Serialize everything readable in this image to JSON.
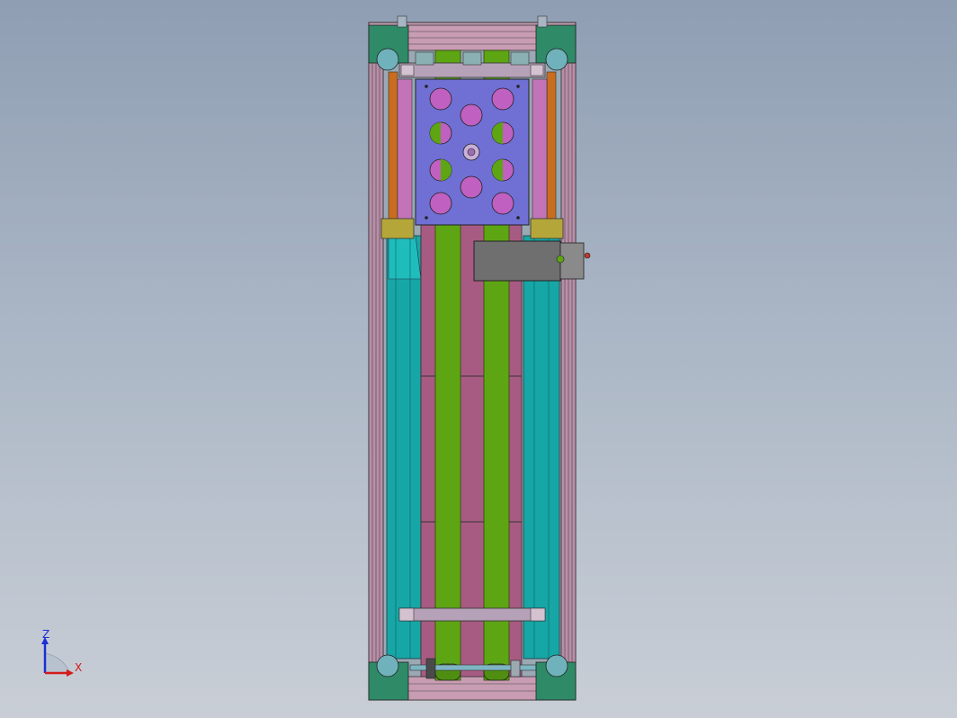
{
  "scene": {
    "view": "cad-model-front-view",
    "colors": {
      "background_top": "#8f9eb3",
      "background_bottom": "#c9ced6",
      "frame": "#b8849a",
      "plate": "#6f6fd4",
      "holes": "#c060c0",
      "belts": "#5ea514",
      "belt_channel": "#a85b82",
      "side_panels": "#17a6a6",
      "corner_brackets": "#2f8a67",
      "motor_box": "#6f6f6f",
      "yellow_blocks": "#b5a63a",
      "orange_rails": "#c86d1e"
    }
  },
  "triad": {
    "z_label": "Z",
    "x_label": "X",
    "z_color": "#1a2fd6",
    "x_color": "#d51a1a"
  }
}
